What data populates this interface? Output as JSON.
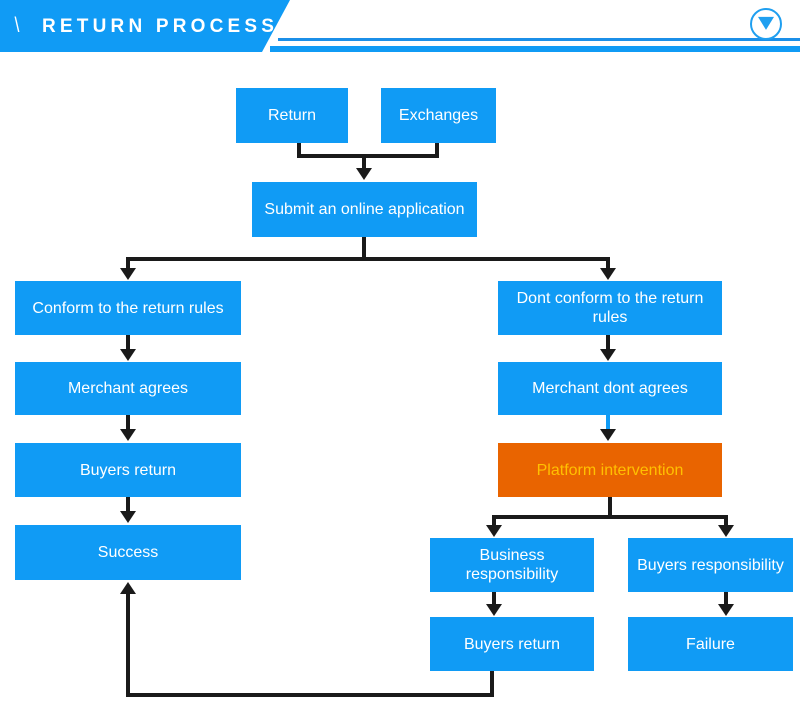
{
  "header": {
    "slash": "\\",
    "title": "RETURN PROCESS",
    "collapse_icon": "circle-chevron-down-icon"
  },
  "colors": {
    "node_blue": "#109bf5",
    "node_orange": "#e96400",
    "orange_text": "#ffc000",
    "node_text": "#ffffff",
    "connector": "#1a1a1a",
    "connector_accent": "#109bf5",
    "background": "#ffffff"
  },
  "chart_data": {
    "type": "diagram",
    "title": "RETURN PROCESS",
    "nodes": [
      {
        "id": "return",
        "label": "Return",
        "color": "#109bf5",
        "text_color": "#ffffff"
      },
      {
        "id": "exchanges",
        "label": "Exchanges",
        "color": "#109bf5",
        "text_color": "#ffffff"
      },
      {
        "id": "submit",
        "label": "Submit an online application",
        "color": "#109bf5",
        "text_color": "#ffffff"
      },
      {
        "id": "conform",
        "label": "Conform to the return rules",
        "color": "#109bf5",
        "text_color": "#ffffff"
      },
      {
        "id": "merchant_agrees",
        "label": "Merchant agrees",
        "color": "#109bf5",
        "text_color": "#ffffff"
      },
      {
        "id": "buyers_return_l",
        "label": "Buyers return",
        "color": "#109bf5",
        "text_color": "#ffffff"
      },
      {
        "id": "success",
        "label": "Success",
        "color": "#109bf5",
        "text_color": "#ffffff"
      },
      {
        "id": "dont_conform",
        "label": "Dont conform to the return rules",
        "color": "#109bf5",
        "text_color": "#ffffff"
      },
      {
        "id": "merchant_dont",
        "label": "Merchant dont agrees",
        "color": "#109bf5",
        "text_color": "#ffffff"
      },
      {
        "id": "platform",
        "label": "Platform intervention",
        "color": "#e96400",
        "text_color": "#ffc000"
      },
      {
        "id": "business_resp",
        "label": "Business responsibility",
        "color": "#109bf5",
        "text_color": "#ffffff"
      },
      {
        "id": "buyers_return_r",
        "label": "Buyers return",
        "color": "#109bf5",
        "text_color": "#ffffff"
      },
      {
        "id": "buyers_resp",
        "label": "Buyers responsibility",
        "color": "#109bf5",
        "text_color": "#ffffff"
      },
      {
        "id": "failure",
        "label": "Failure",
        "color": "#109bf5",
        "text_color": "#ffffff"
      }
    ],
    "edges": [
      {
        "from": "return",
        "to": "submit",
        "style": "elbow",
        "color": "#1a1a1a"
      },
      {
        "from": "exchanges",
        "to": "submit",
        "style": "elbow",
        "color": "#1a1a1a"
      },
      {
        "from": "submit",
        "to": "conform",
        "style": "elbow",
        "color": "#1a1a1a"
      },
      {
        "from": "submit",
        "to": "dont_conform",
        "style": "elbow",
        "color": "#1a1a1a"
      },
      {
        "from": "conform",
        "to": "merchant_agrees",
        "style": "straight",
        "color": "#1a1a1a"
      },
      {
        "from": "merchant_agrees",
        "to": "buyers_return_l",
        "style": "straight",
        "color": "#1a1a1a"
      },
      {
        "from": "buyers_return_l",
        "to": "success",
        "style": "straight",
        "color": "#1a1a1a"
      },
      {
        "from": "dont_conform",
        "to": "merchant_dont",
        "style": "straight",
        "color": "#1a1a1a"
      },
      {
        "from": "merchant_dont",
        "to": "platform",
        "style": "straight",
        "color": "#109bf5"
      },
      {
        "from": "platform",
        "to": "business_resp",
        "style": "elbow",
        "color": "#1a1a1a"
      },
      {
        "from": "platform",
        "to": "buyers_resp",
        "style": "elbow",
        "color": "#1a1a1a"
      },
      {
        "from": "business_resp",
        "to": "buyers_return_r",
        "style": "straight",
        "color": "#1a1a1a"
      },
      {
        "from": "buyers_resp",
        "to": "failure",
        "style": "straight",
        "color": "#1a1a1a"
      },
      {
        "from": "buyers_return_r",
        "to": "success",
        "style": "feedback-loop",
        "color": "#1a1a1a"
      }
    ]
  },
  "nodes": {
    "return": "Return",
    "exchanges": "Exchanges",
    "submit": "Submit an online application",
    "conform": "Conform to the return rules",
    "merchant_agrees": "Merchant agrees",
    "buyers_return_left": "Buyers return",
    "success": "Success",
    "dont_conform": "Dont conform to the return rules",
    "merchant_dont_agrees": "Merchant dont agrees",
    "platform_intervention": "Platform intervention",
    "business_responsibility": "Business responsibility",
    "buyers_return_right": "Buyers return",
    "buyers_responsibility": "Buyers responsibility",
    "failure": "Failure"
  }
}
